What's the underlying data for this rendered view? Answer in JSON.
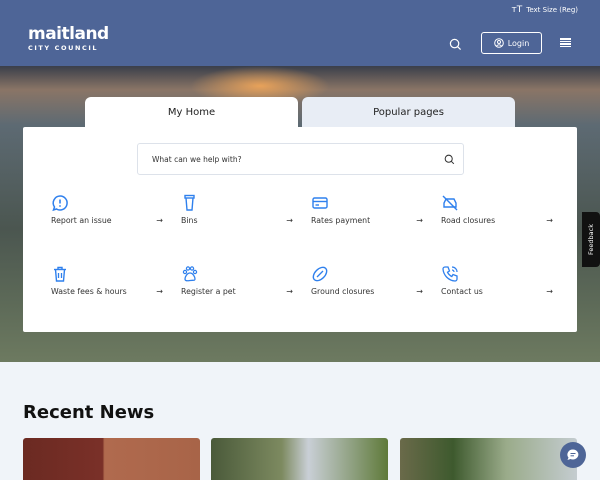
{
  "header": {
    "text_size": "Text Size (Reg)",
    "logo_main": "maitland",
    "logo_sub": "CITY COUNCIL",
    "login": "Login"
  },
  "tabs": [
    {
      "label": "My Home",
      "active": true
    },
    {
      "label": "Popular pages",
      "active": false
    }
  ],
  "search": {
    "placeholder": "What can we help with?"
  },
  "quick_links": [
    {
      "label": "Report an issue",
      "icon": "alert-chat-icon"
    },
    {
      "label": "Bins",
      "icon": "bin-icon"
    },
    {
      "label": "Rates payment",
      "icon": "credit-card-icon"
    },
    {
      "label": "Road closures",
      "icon": "car-off-icon"
    },
    {
      "label": "Waste fees & hours",
      "icon": "trash-icon"
    },
    {
      "label": "Register a pet",
      "icon": "paw-icon"
    },
    {
      "label": "Ground closures",
      "icon": "football-icon"
    },
    {
      "label": "Contact us",
      "icon": "phone-icon"
    }
  ],
  "feedback": "Feedback",
  "news": {
    "title": "Recent News"
  },
  "colors": {
    "brand": "#4e6597",
    "accent": "#2f80ed"
  }
}
